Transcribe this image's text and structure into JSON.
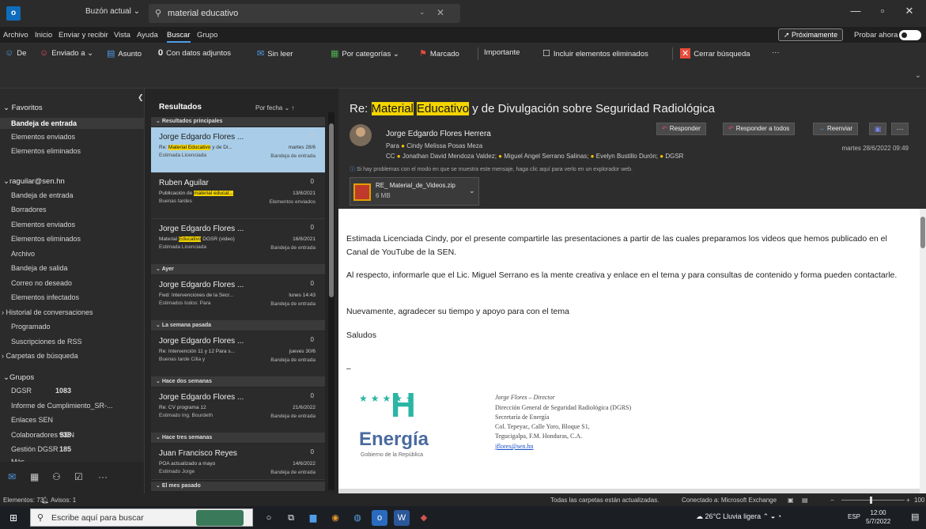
{
  "titlebar": {
    "logo": "o",
    "scope": "Buzón actual ⌄",
    "search_value": "material educativo",
    "search_dropdown": "⌄",
    "search_close": "✕",
    "min": "—",
    "max": "▫",
    "close": "✕"
  },
  "menu": {
    "items": [
      "Archivo",
      "Inicio",
      "Enviar y recibir",
      "Vista",
      "Ayuda",
      "Buscar",
      "Grupo"
    ],
    "active": "Buscar",
    "proximamente": "Próximamente",
    "probar": "Probar ahora"
  },
  "ribbon": {
    "de": "De",
    "enviado_a": "Enviado a ⌄",
    "asunto": "Asunto",
    "adjuntos": "Con datos adjuntos",
    "sin_leer": "Sin leer",
    "categorias": "Por categorías ⌄",
    "marcado": "Marcado",
    "importante": "Importante",
    "incluir": "Incluir elementos eliminados",
    "cerrar": "Cerrar búsqueda",
    "mas": "···"
  },
  "folders": {
    "favoritos": "Favoritos",
    "fav_items": [
      "Bandeja de entrada",
      "Elementos enviados",
      "Elementos eliminados"
    ],
    "account": "raguilar@sen.hn",
    "account_items": [
      "Bandeja de entrada",
      "Borradores",
      "Elementos enviados",
      "Elementos eliminados",
      "Archivo",
      "Bandeja de salida",
      "Correo no deseado",
      "Elementos infectados"
    ],
    "historial": "Historial de conversaciones",
    "programado": "Programado",
    "rss": "Suscripciones de RSS",
    "carpetas_busqueda": "Carpetas de búsqueda",
    "grupos": "Grupos",
    "groups": [
      {
        "name": "DGSR",
        "count": "1083"
      },
      {
        "name": "Informe de Cumplimiento_SR-...",
        "count": ""
      },
      {
        "name": "Enlaces SEN",
        "count": ""
      },
      {
        "name": "Colaboradores SEN",
        "count": "938"
      },
      {
        "name": "Gestión DGSR",
        "count": "185"
      },
      {
        "name": "Más...",
        "count": ""
      }
    ]
  },
  "list": {
    "title": "Resultados",
    "sort": "Por fecha ⌄",
    "sort_arrow": "↑",
    "groups": [
      "Resultados principales",
      "Ayer",
      "La semana pasada",
      "Hace dos semanas",
      "Hace tres semanas",
      "El mes pasado"
    ],
    "messages": [
      {
        "sender": "Jorge Edgardo Flores ...",
        "subject_pre": "Re: ",
        "subject_hl": "Material Educativo",
        "subject_post": " y de Di...",
        "date": "martes 28/6",
        "preview": "Estimada Licenciada",
        "folder": "Bandeja de entrada"
      },
      {
        "sender": "Ruben Aguilar",
        "subject_pre": "Publicación de ",
        "subject_hl": "material educat...",
        "subject_post": "",
        "date": "13/8/2021",
        "preview": "Buenas tardes",
        "folder": "Elementos enviados"
      },
      {
        "sender": "Jorge Edgardo Flores ...",
        "subject_pre": "Material ",
        "subject_hl": "Educativo",
        "subject_post": " DGSR (video)",
        "date": "16/8/2021",
        "preview": "Estimada Licenciada",
        "folder": "Bandeja de entrada"
      },
      {
        "sender": "Jorge Edgardo Flores ...",
        "subject_pre": "Fwd: Intervenciones de la Secr...",
        "subject_hl": "",
        "subject_post": "",
        "date": "lunes 14:43",
        "preview": "Estimados todos: Para",
        "folder": "Bandeja de entrada"
      },
      {
        "sender": "Jorge Edgardo Flores ...",
        "subject_pre": "Re: Intervención 11 y 12 Para s...",
        "subject_hl": "",
        "subject_post": "",
        "date": "jueves 30/6",
        "preview": "Buenas tarde Cilia y",
        "folder": "Bandeja de entrada"
      },
      {
        "sender": "Jorge Edgardo Flores ...",
        "subject_pre": "Re: CV programa 12",
        "subject_hl": "",
        "subject_post": "",
        "date": "21/6/2022",
        "preview": "Estimado Ing. Bourdeth",
        "folder": "Bandeja de entrada"
      },
      {
        "sender": "Juan Francisco Reyes",
        "subject_pre": "POA actualizado a mayo",
        "subject_hl": "",
        "subject_post": "",
        "date": "14/6/2022",
        "preview": "Estimado Jorge",
        "folder": "Bandeja de entrada"
      }
    ]
  },
  "reading": {
    "subject_pre": "Re: ",
    "subject_hl1": "Material",
    "subject_hl2": "Educativo",
    "subject_post": " y de Divulgación sobre Seguridad Radiológica",
    "sender": "Jorge Edgardo Flores Herrera",
    "to_label": "Para",
    "to": "Cindy Melissa Posas Meza",
    "cc_label": "CC",
    "cc": [
      "Jonathan David Mendoza Valdez;",
      "Miguel Angel Serrano Salinas;",
      "Evelyn Bustillo Durón;",
      "DGSR"
    ],
    "info": "Si hay problemas con el modo en que se muestra este mensaje, haga clic aquí para verlo en un explorador web.",
    "attachment_name": "RE_ Material_de_Videos.zip",
    "attachment_size": "6 MB",
    "reply": "Responder",
    "reply_all": "Responder a todos",
    "forward": "Reenviar",
    "date": "martes 28/6/2022 09:49",
    "paragraphs": [
      "Estimada Licenciada Cindy, por el presente compartirle las presentaciones a partir de las cuales preparamos los videos que hemos publicado en el Canal de YouTube de la SEN.",
      "Al respecto, informarle que el Lic. Miguel Serrano es la mente creativa y enlace en el tema y para consultas de contenido y forma pueden contactarle.",
      "Nuevamente, agradecer su tiempo y apoyo para con el tema",
      "Saludos"
    ],
    "dash": "–",
    "logo_h": "H",
    "logo_energia": "Energía",
    "logo_gobierno": "Gobierno de la República",
    "signature": [
      "Jorge Flores – Director",
      "Dirección General de Seguridad Radiológica (DGRS)",
      "Secretaría de Energía",
      "Col. Tepeyac, Calle Yoro, Bloque S1,",
      "Tegucigalpa, F.M. Honduras, C.A."
    ],
    "email": "jflores@sen.hn"
  },
  "status": {
    "items": "Elementos: 73",
    "alerts": "Avisos: 1",
    "updated": "Todas las carpetas están actualizadas.",
    "connected": "Conectado a: Microsoft Exchange",
    "zoom": "100"
  },
  "taskbar": {
    "search_placeholder": "Escribe aquí para buscar",
    "weather": "26°C  Lluvia ligera",
    "lang": "ESP",
    "time": "12:00",
    "date": "5/7/2022"
  }
}
